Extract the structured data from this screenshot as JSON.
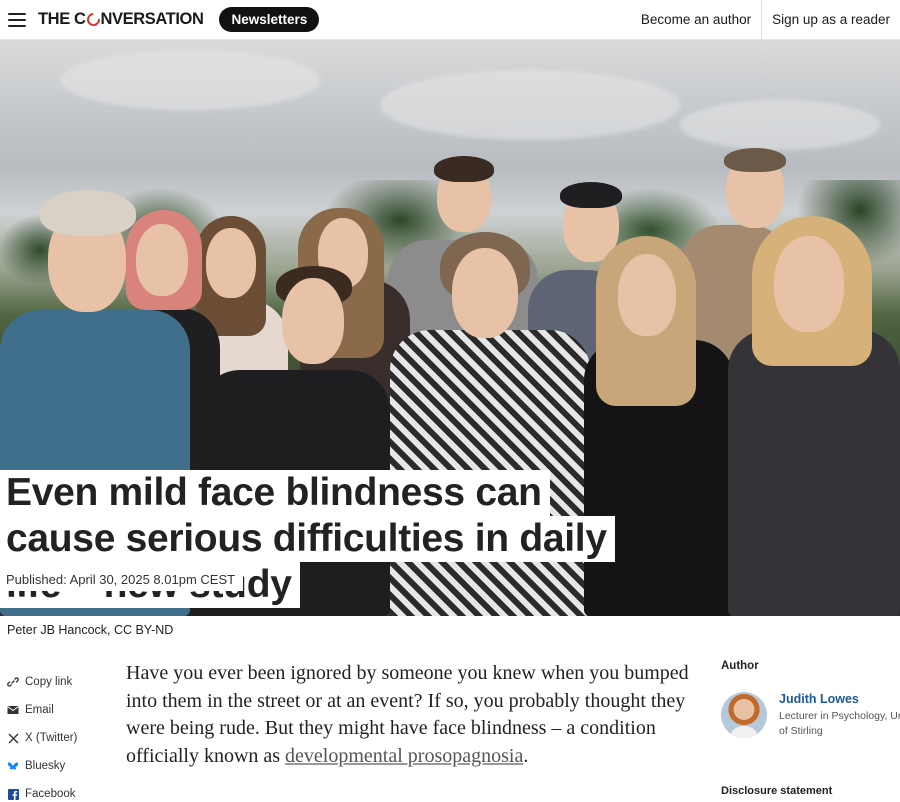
{
  "header": {
    "logo_left": "THE C",
    "logo_right": "NVERSATION",
    "newsletters_label": "Newsletters",
    "become_author_label": "Become an author",
    "sign_up_label": "Sign up as a reader"
  },
  "hero": {
    "image_description_icon": "group-photo",
    "headline_lines": [
      "Even mild face blindness can",
      "cause serious difficulties in daily",
      "life – new study"
    ],
    "published": "Published: April 30, 2025 8.01pm CEST"
  },
  "credit": "Peter JB Hancock, CC BY-ND",
  "share": {
    "items": [
      {
        "label": "Copy link",
        "icon": "link-icon"
      },
      {
        "label": "Email",
        "icon": "email-icon"
      },
      {
        "label": "X (Twitter)",
        "icon": "x-icon"
      },
      {
        "label": "Bluesky",
        "icon": "bluesky-icon"
      },
      {
        "label": "Facebook",
        "icon": "facebook-icon"
      }
    ]
  },
  "article": {
    "para_start": "Have you ever been ignored by someone you knew when you bumped into them in the street or at an event? If so, you probably thought they were being rude. But they might have face blindness – a condition officially known as ",
    "link_text": "developmental prosopagnosia",
    "para_end": "."
  },
  "author": {
    "heading": "Author",
    "name": "Judith Lowes",
    "role_line1": "Lecturer in Psychology, Ur",
    "role_line2": "of Stirling",
    "disclosure": "Disclosure statement"
  },
  "colors": {
    "logo_accent": "#d8352a",
    "author_link": "#1d5a99",
    "bluesky": "#1185fe",
    "facebook": "#1a4a9a"
  }
}
